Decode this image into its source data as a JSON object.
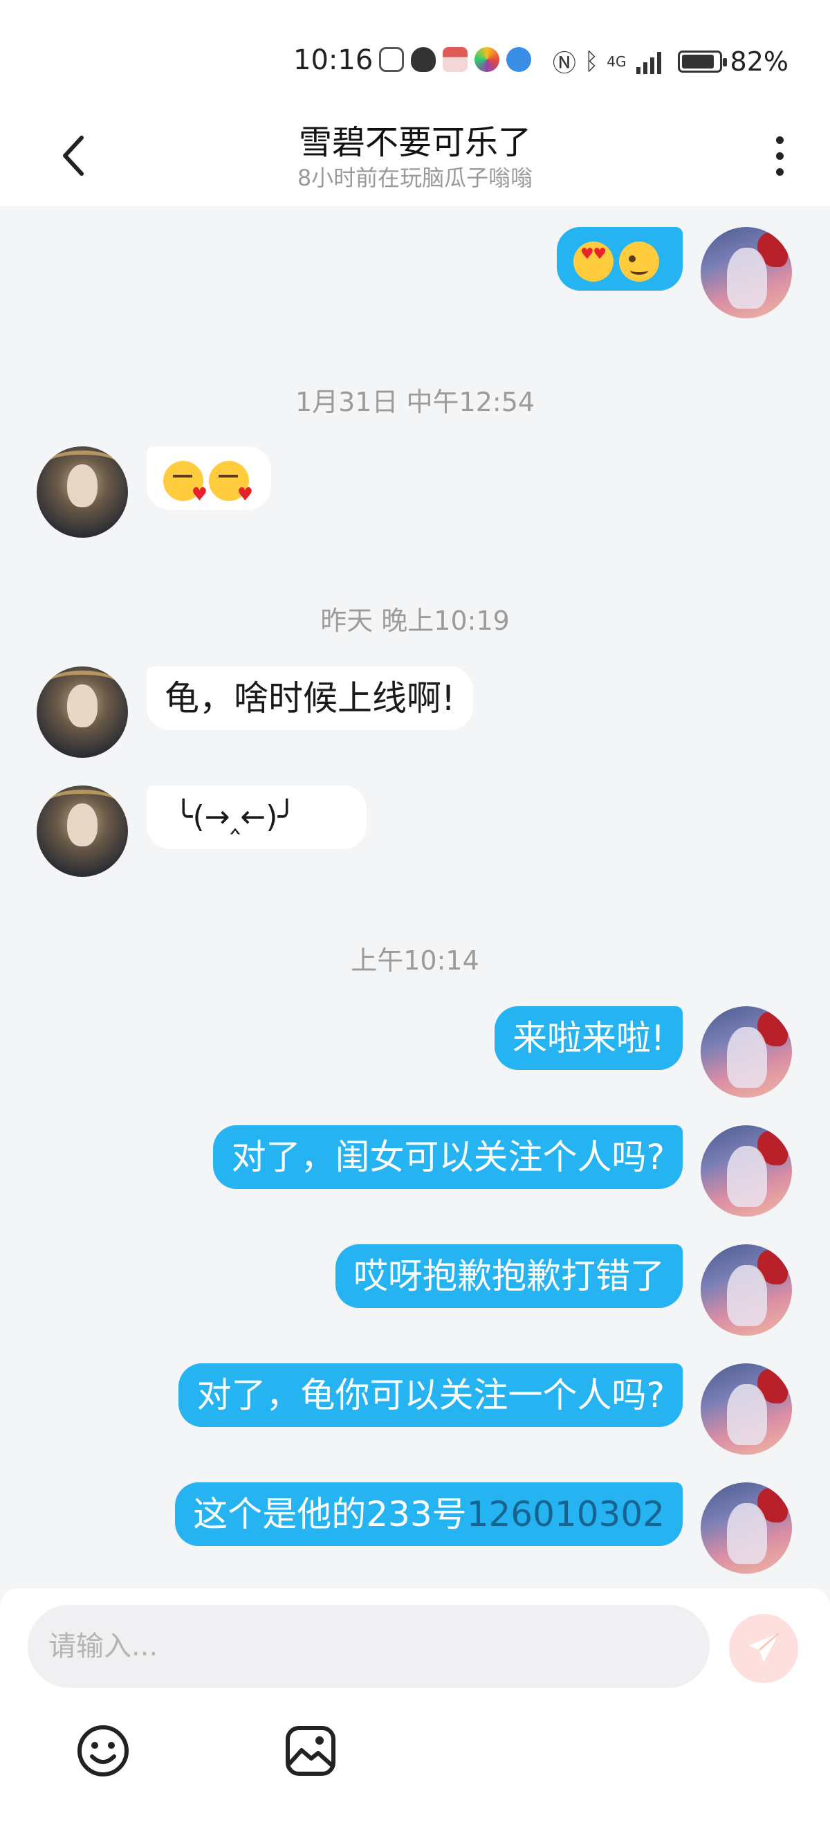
{
  "status_bar": {
    "time": "10:16",
    "network_label": "4G",
    "battery_text": "82%",
    "battery_level": 0.82
  },
  "header": {
    "title": "雪碧不要可乐了",
    "subtitle": "8小时前在玩脑瓜子嗡嗡"
  },
  "messages": {
    "m0": "",
    "ts1": "1月31日 中午12:54",
    "m1": "",
    "ts2": "昨天 晚上10:19",
    "m2": "龟，啥时候上线啊!",
    "m3": "╰(→‸←)╯",
    "ts3": "上午10:14",
    "m4": "来啦来啦!",
    "m5": "对了，闺女可以关注个人吗?",
    "m6": "哎呀抱歉抱歉打错了",
    "m7": "对了，龟你可以关注一个人吗?",
    "m8_prefix": "这个是他的233号",
    "m8_link": "126010302"
  },
  "composer": {
    "placeholder": "请输入..."
  },
  "colors": {
    "accent_bubble": "#25b3f2",
    "link": "#16648f",
    "send_disabled": "#fde0dd"
  }
}
